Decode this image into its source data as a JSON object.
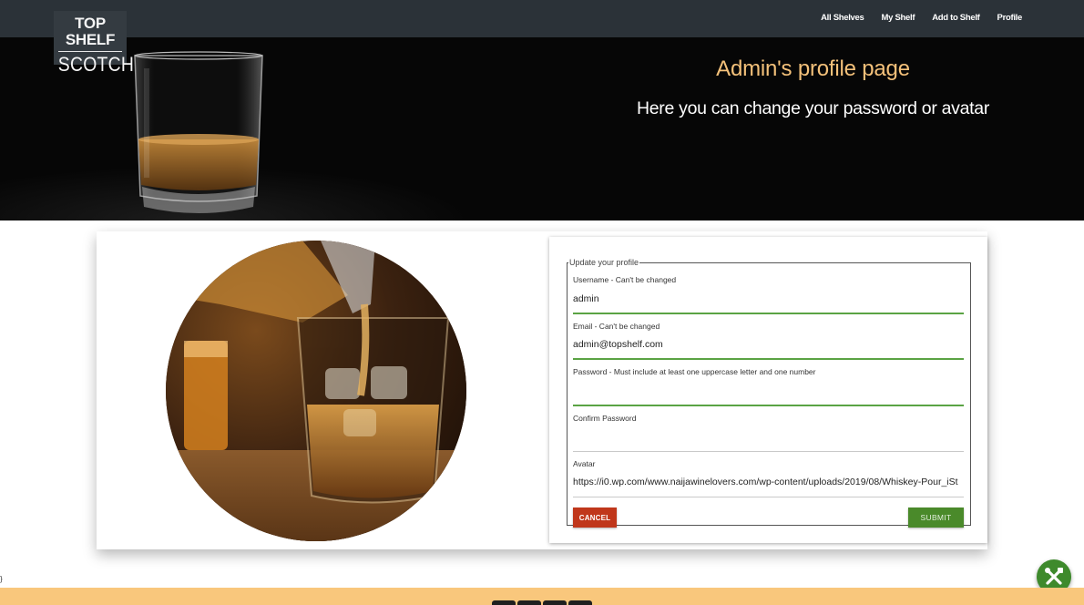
{
  "logo": {
    "line1": "TOP SHELF",
    "line2": "SCOTCH"
  },
  "nav": {
    "items": [
      {
        "label": "All Shelves"
      },
      {
        "label": "My Shelf"
      },
      {
        "label": "Add to Shelf"
      },
      {
        "label": "Profile"
      }
    ]
  },
  "hero": {
    "title": "Admin's profile page",
    "subtitle": "Here you can change your password or avatar"
  },
  "form": {
    "legend": "Update your profile",
    "fields": [
      {
        "label": "Username - Can't be changed",
        "value": "admin"
      },
      {
        "label": "Email - Can't be changed",
        "value": "admin@topshelf.com"
      },
      {
        "label": "Password - Must include at least one uppercase letter and one number",
        "value": ""
      },
      {
        "label": "Confirm Password",
        "value": ""
      },
      {
        "label": "Avatar",
        "value": "https://i0.wp.com/www.naijawinelovers.com/wp-content/uploads/2019/08/Whiskey-Pour_iSt"
      }
    ],
    "cancel_label": "CANCEL",
    "submit_label": "SUBMIT"
  },
  "stray_text": "}",
  "colors": {
    "navbar": "#2b3238",
    "hero_title": "#f4c17a",
    "cancel": "#c0371b",
    "submit": "#4a8a2a",
    "valid_underline": "#5aa344",
    "footer": "#f9c77c"
  },
  "icons": {
    "fab": "tools-icon",
    "footer": [
      "social-icon-1",
      "social-icon-2",
      "social-icon-3",
      "social-icon-4"
    ]
  }
}
